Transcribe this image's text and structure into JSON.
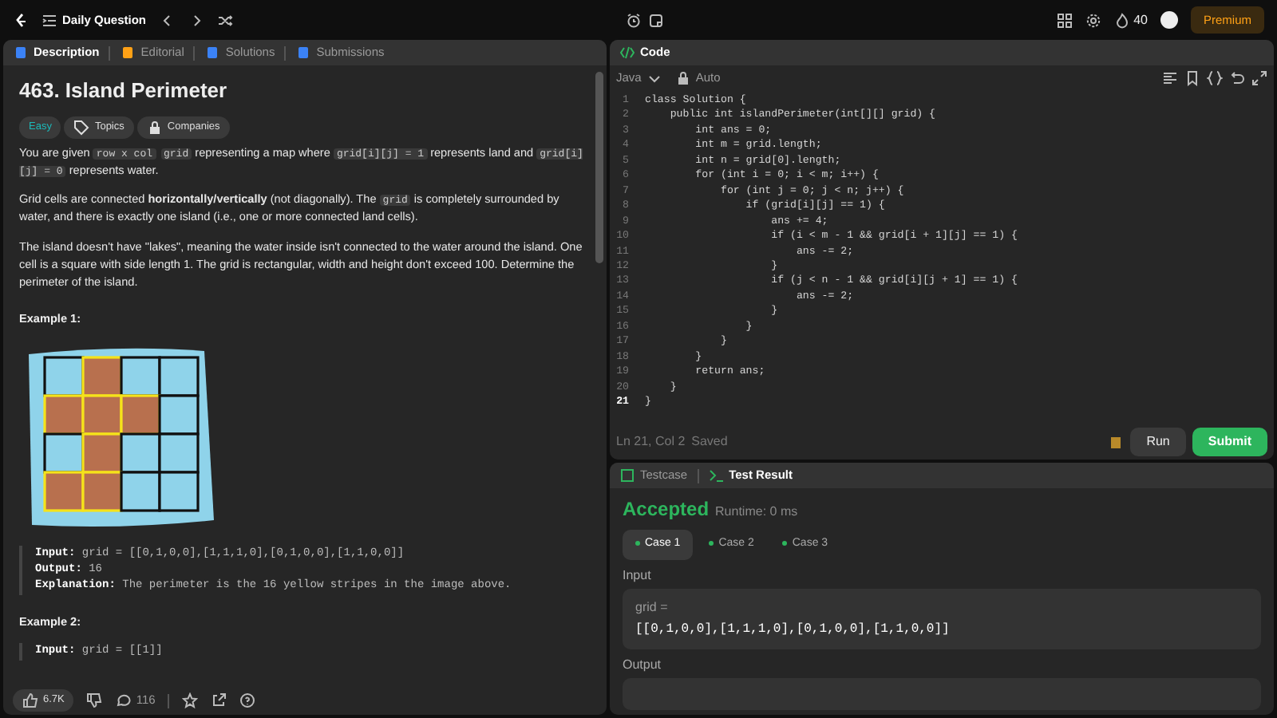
{
  "topbar": {
    "title": "Daily Question",
    "streak": "40",
    "premium": "Premium"
  },
  "left_tabs": [
    {
      "label": "Description",
      "selected": true
    },
    {
      "label": "Editorial",
      "selected": false
    },
    {
      "label": "Solutions",
      "selected": false
    },
    {
      "label": "Submissions",
      "selected": false
    }
  ],
  "problem": {
    "title": "463. Island Perimeter",
    "difficulty": "Easy",
    "tags": [
      "Topics",
      "Companies"
    ],
    "paragraphs": [
      [
        {
          "kind": "text",
          "text": "You are given "
        },
        {
          "kind": "code",
          "text": "row x col"
        },
        {
          "kind": "code",
          "text": "grid"
        },
        {
          "kind": "text",
          "text": " representing a map where "
        },
        {
          "kind": "code",
          "text": "grid[i][j] = 1"
        },
        {
          "kind": "text",
          "text": " represents land and "
        },
        {
          "kind": "code",
          "text": "grid[i][j] = 0"
        },
        {
          "kind": "text",
          "text": " represents water."
        }
      ],
      [
        {
          "kind": "text",
          "text": "Grid cells are connected "
        },
        {
          "kind": "bold",
          "text": "horizontally/vertically"
        },
        {
          "kind": "text",
          "text": " (not diagonally). The "
        },
        {
          "kind": "code",
          "text": "grid"
        },
        {
          "kind": "text",
          "text": " is completely surrounded by water, and there is exactly one island (i.e., one or more connected land cells)."
        }
      ],
      [
        {
          "kind": "text",
          "text": "The island doesn't have \"lakes\", meaning the water inside isn't connected to the water around the island. One cell is a square with side length 1. The grid is rectangular, width and height don't exceed 100. Determine the perimeter of the island."
        }
      ]
    ],
    "examples": [
      {
        "title": "Example 1:",
        "figure": true,
        "lines": [
          {
            "label": "Input:",
            "value": "grid = [[0,1,0,0],[1,1,1,0],[0,1,0,0],[1,1,0,0]]"
          },
          {
            "label": "Output:",
            "value": "16"
          },
          {
            "label": "Explanation:",
            "value": "The perimeter is the 16 yellow stripes in the image above."
          }
        ]
      },
      {
        "title": "Example 2:",
        "lines": [
          {
            "label": "Input:",
            "value": "grid = [[1]]"
          }
        ]
      }
    ]
  },
  "footer": {
    "likes": "6.7K",
    "comments": "116"
  },
  "code": {
    "title": "Code",
    "language": "Java",
    "mode": "Auto",
    "lines": [
      {
        "number": "1",
        "text": "class Solution {",
        "current": false
      },
      {
        "number": "2",
        "text": "    public int islandPerimeter(int[][] grid) {",
        "current": false
      },
      {
        "number": "3",
        "text": "        int ans = 0;",
        "current": false
      },
      {
        "number": "4",
        "text": "        int m = grid.length;",
        "current": false
      },
      {
        "number": "5",
        "text": "        int n = grid[0].length;",
        "current": false
      },
      {
        "number": "6",
        "text": "        for (int i = 0; i < m; i++) {",
        "current": false
      },
      {
        "number": "7",
        "text": "            for (int j = 0; j < n; j++) {",
        "current": false
      },
      {
        "number": "8",
        "text": "                if (grid[i][j] == 1) {",
        "current": false
      },
      {
        "number": "9",
        "text": "                    ans += 4;",
        "current": false
      },
      {
        "number": "10",
        "text": "                    if (i < m - 1 && grid[i + 1][j] == 1) {",
        "current": false
      },
      {
        "number": "11",
        "text": "                        ans -= 2;",
        "current": false
      },
      {
        "number": "12",
        "text": "                    }",
        "current": false
      },
      {
        "number": "13",
        "text": "                    if (j < n - 1 && grid[i][j + 1] == 1) {",
        "current": false
      },
      {
        "number": "14",
        "text": "                        ans -= 2;",
        "current": false
      },
      {
        "number": "15",
        "text": "                    }",
        "current": false
      },
      {
        "number": "16",
        "text": "                }",
        "current": false
      },
      {
        "number": "17",
        "text": "            }",
        "current": false
      },
      {
        "number": "18",
        "text": "        }",
        "current": false
      },
      {
        "number": "19",
        "text": "        return ans;",
        "current": false
      },
      {
        "number": "20",
        "text": "    }",
        "current": false
      },
      {
        "number": "21",
        "text": "}",
        "current": true
      }
    ],
    "status": "Ln 21, Col 2",
    "saved": "Saved",
    "run": "Run",
    "submit": "Submit"
  },
  "result_tabs": [
    {
      "label": "Testcase",
      "selected": false
    },
    {
      "label": "Test Result",
      "selected": true
    }
  ],
  "result": {
    "verdict": "Accepted",
    "runtime": "Runtime: 0 ms",
    "cases": [
      {
        "label": "Case 1",
        "selected": true
      },
      {
        "label": "Case 2",
        "selected": false
      },
      {
        "label": "Case 3",
        "selected": false
      }
    ],
    "input_label": "Input",
    "input_name": "grid =",
    "input_value": "[[0,1,0,0],[1,1,1,0],[0,1,0,0],[1,1,0,0]]",
    "output_label": "Output"
  }
}
